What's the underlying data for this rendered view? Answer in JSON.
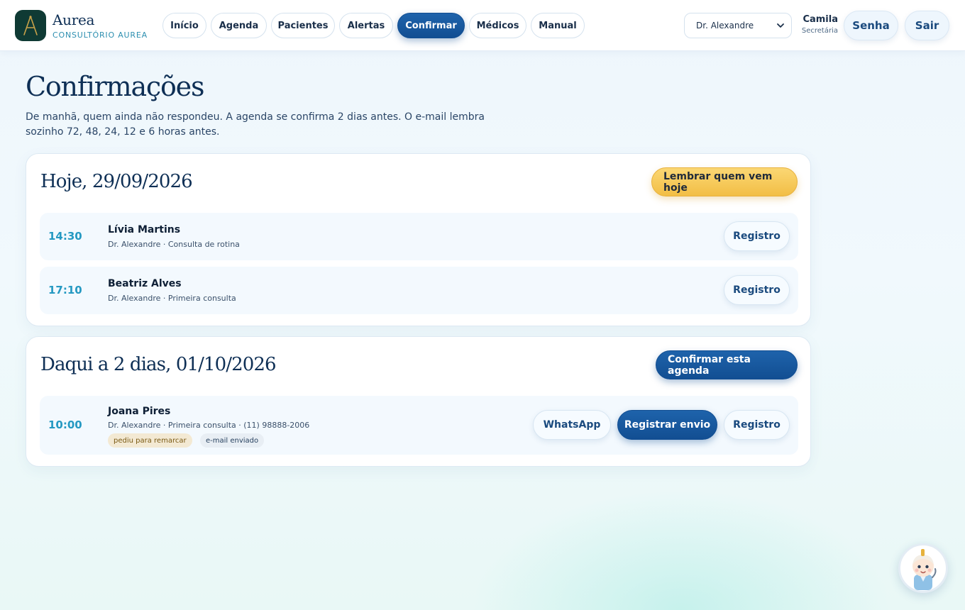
{
  "brand": {
    "name": "Aurea",
    "subtitle": "CONSULTÓRIO AUREA",
    "logo_icon": "compass-a-icon"
  },
  "nav": [
    "Início",
    "Agenda",
    "Pacientes",
    "Alertas",
    "Confirmar",
    "Médicos",
    "Manual"
  ],
  "nav_active": "Confirmar",
  "doctor_select": {
    "value": "Dr. Alexandre"
  },
  "user": {
    "name": "Camila",
    "role": "Secretária"
  },
  "top_buttons": {
    "password": "Senha",
    "logout": "Sair"
  },
  "page": {
    "title": "Confirmações",
    "subtitle": "De manhã, quem ainda não respondeu. A agenda se confirma 2 dias antes. O e-mail lembra sozinho 72, 48, 24, 12 e 6 horas antes."
  },
  "today": {
    "title": "Hoje, 29/09/2026",
    "action": "Lembrar quem vem hoje",
    "appointments": [
      {
        "time": "14:30",
        "name": "Lívia Martins",
        "meta": "Dr. Alexandre · Consulta de rotina",
        "record": "Registro"
      },
      {
        "time": "17:10",
        "name": "Beatriz Alves",
        "meta": "Dr. Alexandre · Primeira consulta",
        "record": "Registro"
      }
    ]
  },
  "upcoming": {
    "title": "Daqui a 2 dias, 01/10/2026",
    "action": "Confirmar esta agenda",
    "appointments": [
      {
        "time": "10:00",
        "name": "Joana Pires",
        "meta": "Dr. Alexandre · Primeira consulta · (11) 98888-2006",
        "tags": [
          "pediu para remarcar",
          "e-mail enviado"
        ],
        "whatsapp": "WhatsApp",
        "register_send": "Registrar envio",
        "record": "Registro"
      }
    ]
  },
  "colors": {
    "navy": "#0e2f55",
    "accent_blue": "#124e92",
    "teal_time": "#2599c2",
    "gold": "#f2be45"
  },
  "assistant": {
    "icon": "doctor-mascot-icon"
  }
}
